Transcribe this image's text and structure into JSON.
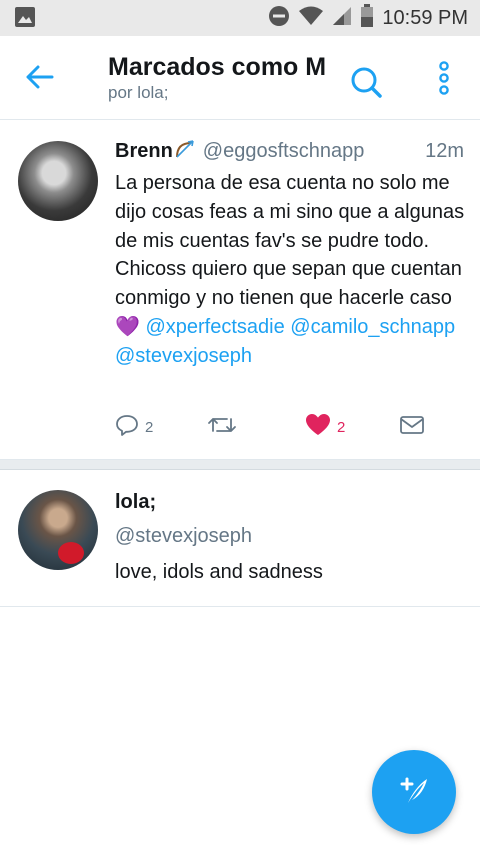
{
  "status_bar": {
    "time": "10:59 PM",
    "icons": [
      "gallery-icon",
      "do-not-disturb-icon",
      "wifi-icon",
      "signal-icon",
      "battery-icon"
    ]
  },
  "app_bar": {
    "title": "Marcados como M",
    "subtitle": "por lola;",
    "icons": [
      "back-arrow-icon",
      "search-icon",
      "more-vertical-icon"
    ],
    "accent_color": "#1da1f2"
  },
  "tweets": [
    {
      "author": "Brenn",
      "handle": "@eggosftschnapp",
      "time": "12m",
      "text": "La persona de esa cuenta no solo me dijo cosas feas a mi sino que a algunas de mis cuentas fav's se pudre todo. Chicoss quiero que sepan que cuentan conmigo y no tienen que hacerle caso",
      "emoji": "💜",
      "mentions": "@xperfectsadie @camilo_schnapp @stevexjoseph",
      "actions": {
        "reply_count": "2",
        "retweet_count": "",
        "like_count": "2",
        "liked": true
      }
    }
  ],
  "user_card": {
    "name": "lola;",
    "handle": "@stevexjoseph",
    "bio": "love, idols and sadness"
  },
  "fab": {
    "icon": "compose-tweet-icon"
  },
  "colors": {
    "accent": "#1da1f2",
    "like": "#e0245e",
    "secondary_text": "#657786"
  }
}
